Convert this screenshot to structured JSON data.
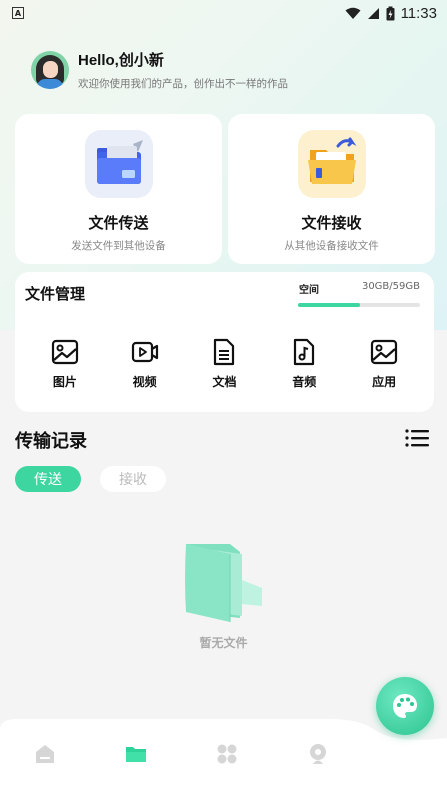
{
  "status_bar": {
    "time": "11:33",
    "notification_badge": "A"
  },
  "profile": {
    "greeting": "Hello,创小新",
    "subtitle": "欢迎你使用我们的产品，创作出不一样的作品"
  },
  "send_card": {
    "title": "文件传送",
    "subtitle": "发送文件到其他设备"
  },
  "receive_card": {
    "title": "文件接收",
    "subtitle": "从其他设备接收文件"
  },
  "file_management": {
    "title": "文件管理",
    "space_label": "空间",
    "space_value": "30GB/59GB",
    "space_used_fraction": 0.51,
    "items": [
      {
        "label": "图片",
        "icon": "image-icon"
      },
      {
        "label": "视频",
        "icon": "video-icon"
      },
      {
        "label": "文档",
        "icon": "document-icon"
      },
      {
        "label": "音频",
        "icon": "audio-icon"
      },
      {
        "label": "应用",
        "icon": "app-icon"
      }
    ]
  },
  "records": {
    "title": "传输记录",
    "tabs": [
      {
        "label": "传送",
        "active": true
      },
      {
        "label": "接收",
        "active": false
      }
    ],
    "empty_text": "暂无文件"
  },
  "bottom_nav": [
    {
      "icon": "home-icon",
      "active": false
    },
    {
      "icon": "files-icon",
      "active": true
    },
    {
      "icon": "grid-icon",
      "active": false
    },
    {
      "icon": "profile-icon",
      "active": false
    }
  ],
  "colors": {
    "accent": "#3ed6a0",
    "inactive": "#d6d6d6"
  }
}
